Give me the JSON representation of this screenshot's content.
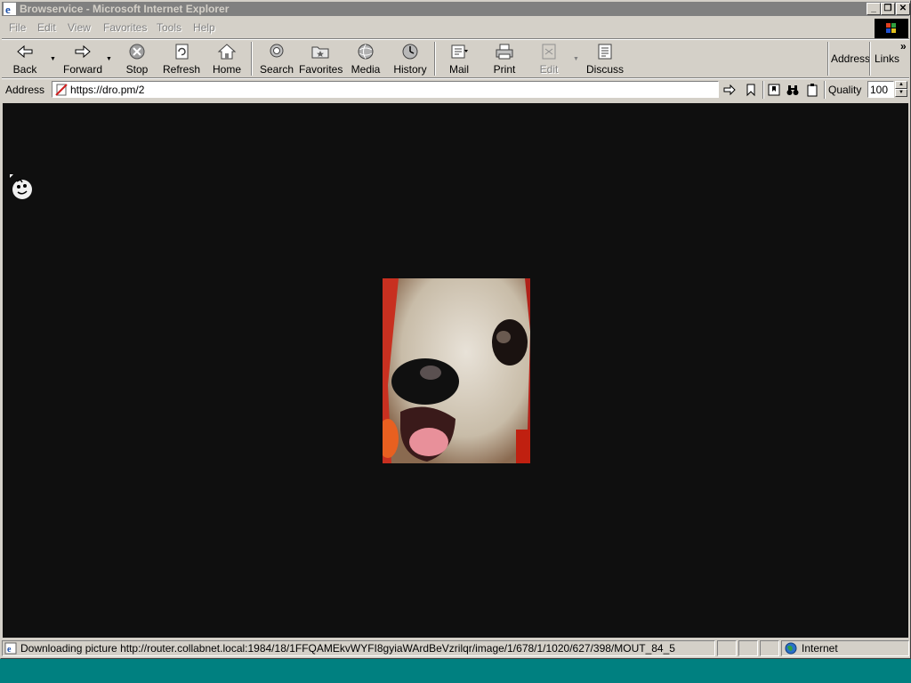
{
  "window": {
    "title": "Browservice - Microsoft Internet Explorer",
    "caption_buttons": {
      "minimize": "_",
      "restore": "❐",
      "close": "✕"
    }
  },
  "menu": [
    "File",
    "Edit",
    "View",
    "Favorites",
    "Tools",
    "Help"
  ],
  "toolbar": {
    "back": "Back",
    "forward": "Forward",
    "stop": "Stop",
    "refresh": "Refresh",
    "home": "Home",
    "search": "Search",
    "favorites": "Favorites",
    "media": "Media",
    "history": "History",
    "mail": "Mail",
    "print": "Print",
    "edit": "Edit",
    "discuss": "Discuss",
    "address": "Address",
    "links": "Links",
    "chevron": "»"
  },
  "addressbar": {
    "label": "Address",
    "url": "https://dro.pm/2",
    "quality_label": "Quality",
    "quality_value": "100"
  },
  "statusbar": {
    "message": "Downloading picture http://router.collabnet.local:1984/18/1FFQAMEkvWYFI8gyiaWArdBeVzrilqr/image/1/678/1/1020/627/398/MOUT_84_5",
    "zone": "Internet"
  },
  "colors": {
    "window_bg": "#d4d0c8",
    "desktop": "#008080",
    "content_bg": "#0f0f0f",
    "titlebar_inactive": "#808080"
  }
}
